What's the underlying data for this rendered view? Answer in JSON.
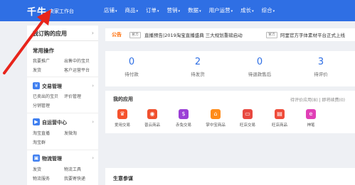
{
  "header": {
    "logo": "千牛",
    "logo_sub": "卖家工作台",
    "nav": [
      "店铺",
      "商品",
      "订单",
      "营销",
      "数据",
      "用户运营",
      "成长",
      "综合"
    ]
  },
  "sidebar": {
    "title": "我订购的应用",
    "common_title": "常用操作",
    "common_links": [
      "我要推广",
      "出售中的宝贝",
      "发货",
      "客户运营平台"
    ],
    "sections": [
      {
        "icon": "trade-icon",
        "title": "交易管理",
        "links": [
          "已卖出的宝贝",
          "评价管理",
          "分销管理"
        ]
      },
      {
        "icon": "media-icon",
        "title": "自运营中心",
        "links": [
          "淘宝直播",
          "发微淘",
          "淘宝群"
        ]
      },
      {
        "icon": "logistics-icon",
        "title": "物流管理",
        "links": [
          "发货",
          "物流工具",
          "物流服务",
          "我要寄快递"
        ]
      }
    ]
  },
  "notice": {
    "label": "公告",
    "items": [
      {
        "tag": "官方",
        "text": "直播预告|2019淘宝直播盛典 三大规划重磅启动"
      },
      {
        "tag": "官方",
        "text": "阿里官方字体素材平台正式上线"
      }
    ]
  },
  "stats": [
    {
      "value": "0",
      "label": "待付款"
    },
    {
      "value": "2",
      "label": "待发货"
    },
    {
      "value": "0",
      "label": "待退款售后"
    },
    {
      "value": "3",
      "label": "待评价"
    }
  ],
  "apps": {
    "title": "我的应用",
    "links": "待评价应用(8) | 即将续费(0)",
    "items": [
      {
        "icon": "crown-icon",
        "label": "爱用交易",
        "color": "#f5522d"
      },
      {
        "icon": "eye-icon",
        "label": "普云商品",
        "color": "#f0502e"
      },
      {
        "icon": "price-tag-icon",
        "label": "赤兔交易",
        "color": "#9b3fd6"
      },
      {
        "icon": "shop-icon",
        "label": "掌中宝商品",
        "color": "#ff8c1a"
      },
      {
        "icon": "monitor-icon",
        "label": "旺店交易",
        "color": "#e8483f"
      },
      {
        "icon": "wallet-icon",
        "label": "旺店商品",
        "color": "#ef4b3a"
      },
      {
        "icon": "e-icon",
        "label": "神笔",
        "color": "#e03fb6"
      }
    ]
  },
  "business": {
    "title": "生意参谋"
  },
  "colors": {
    "brand_blue": "#2f6fe4",
    "notice_orange": "#ff6a00",
    "annotation_red": "#e8241b"
  }
}
